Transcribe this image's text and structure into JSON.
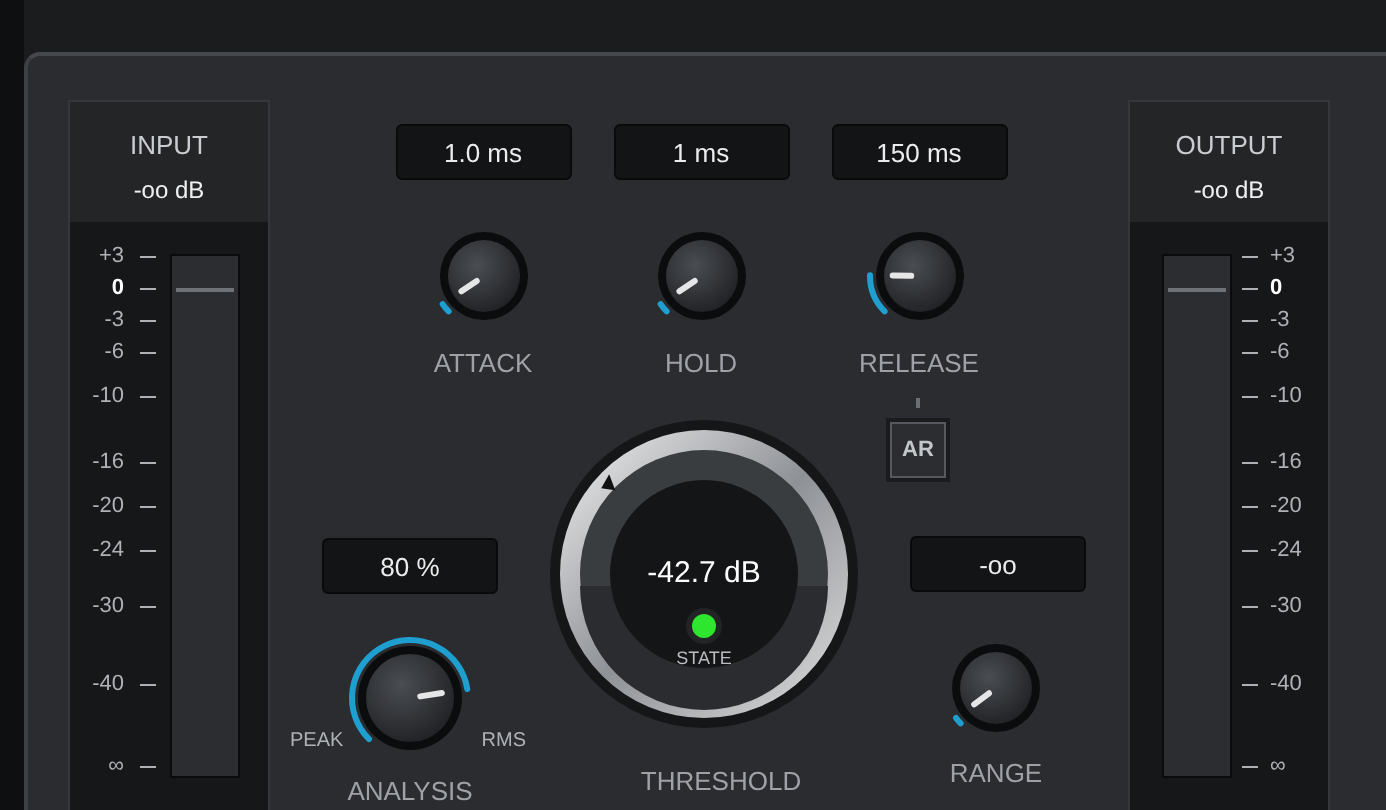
{
  "input_meter": {
    "title": "INPUT",
    "reading": "-oo dB",
    "scale": [
      {
        "label": "+3",
        "bold": false
      },
      {
        "label": "0",
        "bold": true
      },
      {
        "label": "-3",
        "bold": false
      },
      {
        "label": "-6",
        "bold": false
      },
      {
        "label": "-10",
        "bold": false
      },
      {
        "label": "-16",
        "bold": false
      },
      {
        "label": "-20",
        "bold": false
      },
      {
        "label": "-24",
        "bold": false
      },
      {
        "label": "-30",
        "bold": false
      },
      {
        "label": "-40",
        "bold": false
      },
      {
        "label": "∞",
        "bold": false
      }
    ]
  },
  "controls": [
    {
      "name": "ATTACK",
      "value": "1.0 ms"
    },
    {
      "name": "HOLD",
      "value": "1 ms"
    },
    {
      "name": "RELEASE",
      "value": "150 ms"
    }
  ],
  "ar_button": {
    "label": "AR",
    "on": false
  },
  "analysis": {
    "name": "ANALYSIS",
    "value": "80 %",
    "min_label": "PEAK",
    "max_label": "RMS"
  },
  "threshold": {
    "name": "THRESHOLD",
    "value": "-42.7 dB",
    "state_label": "STATE",
    "state_on": true
  },
  "range": {
    "name": "RANGE",
    "value": "-oo"
  },
  "output_meter": {
    "title": "OUTPUT",
    "reading": "-oo dB",
    "scale": [
      {
        "label": "+3",
        "bold": false
      },
      {
        "label": "0",
        "bold": true
      },
      {
        "label": "-3",
        "bold": false
      },
      {
        "label": "-6",
        "bold": false
      },
      {
        "label": "-10",
        "bold": false
      },
      {
        "label": "-16",
        "bold": false
      },
      {
        "label": "-20",
        "bold": false
      },
      {
        "label": "-24",
        "bold": false
      },
      {
        "label": "-30",
        "bold": false
      },
      {
        "label": "-40",
        "bold": false
      },
      {
        "label": "∞",
        "bold": false
      }
    ]
  }
}
